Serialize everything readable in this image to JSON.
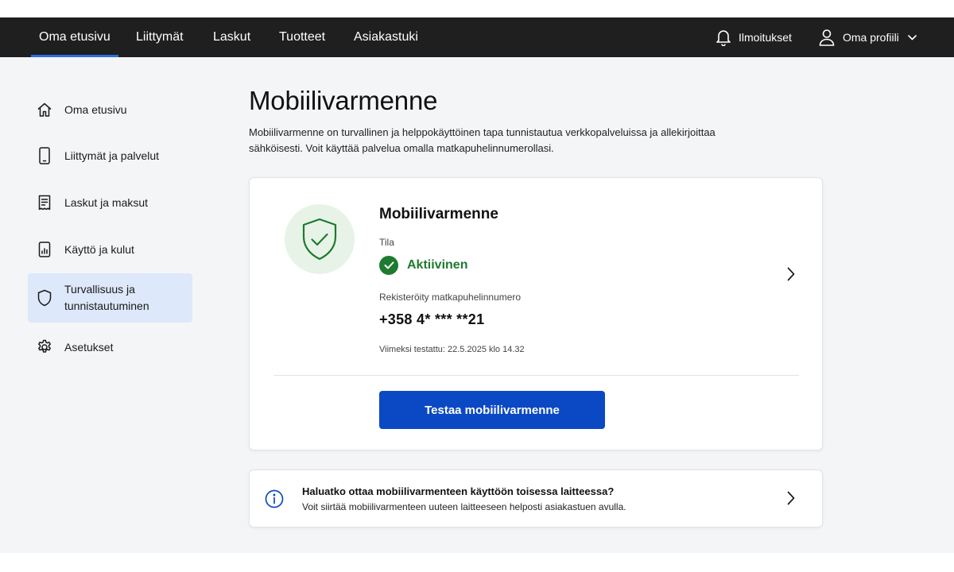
{
  "topnav": {
    "items": [
      {
        "label": "Oma etusivu",
        "active": true
      },
      {
        "label": "Liittymät",
        "active": false
      },
      {
        "label": "Laskut",
        "active": false
      },
      {
        "label": "Tuotteet",
        "active": false
      },
      {
        "label": "Asiakastuki",
        "active": false
      }
    ],
    "notifications": {
      "label": "Ilmoitukset",
      "icon": "bell-icon"
    },
    "profile": {
      "label": "Oma profiili",
      "icon": "user-icon"
    }
  },
  "sidebar": {
    "items": [
      {
        "label": "Oma etusivu",
        "icon": "home-icon",
        "active": false
      },
      {
        "label": "Liittymät ja palvelut",
        "icon": "phone-icon",
        "active": false
      },
      {
        "label": "Laskut ja maksut",
        "icon": "invoice-icon",
        "active": false
      },
      {
        "label": "Käyttö ja kulut",
        "icon": "usage-icon",
        "active": false
      },
      {
        "label_line1": "Turvallisuus ja",
        "label_line2": "tunnistautuminen",
        "icon": "shield-icon",
        "active": true
      },
      {
        "label": "Asetukset",
        "icon": "gear-icon",
        "active": false
      }
    ]
  },
  "page": {
    "title": "Mobiilivarmenne",
    "description_line1": "Mobiilivarmenne on turvallinen ja helppokäyttöinen tapa tunnistautua verkkopalveluissa ja allekirjoittaa",
    "description_line2": "sähköisesti. Voit käyttää palvelua omalla matkapuhelinnumerollasi."
  },
  "card": {
    "title": "Mobiilivarmenne",
    "status_label": "Tila",
    "status_value": "Aktiivinen",
    "phone_label": "Rekisteröity matkapuhelinnumero",
    "phone_value": "+358 4* *** **21",
    "last_tested": "Viimeksi testattu: 22.5.2025 klo 14.32",
    "button_label": "Testaa mobiilivarmenne"
  },
  "info": {
    "title": "Haluatko ottaa mobiilivarmenteen käyttöön toisessa laitteessa?",
    "description": "Voit siirtää mobiilivarmenteen uuteen laitteeseen helposti asiakastuen avulla."
  },
  "colors": {
    "topbar_bg": "#1f1f1f",
    "accent_blue": "#0b49c4",
    "active_underline": "#2d6ee0",
    "status_green": "#1e7a2f",
    "sidebar_active_bg": "#dde8fa"
  }
}
